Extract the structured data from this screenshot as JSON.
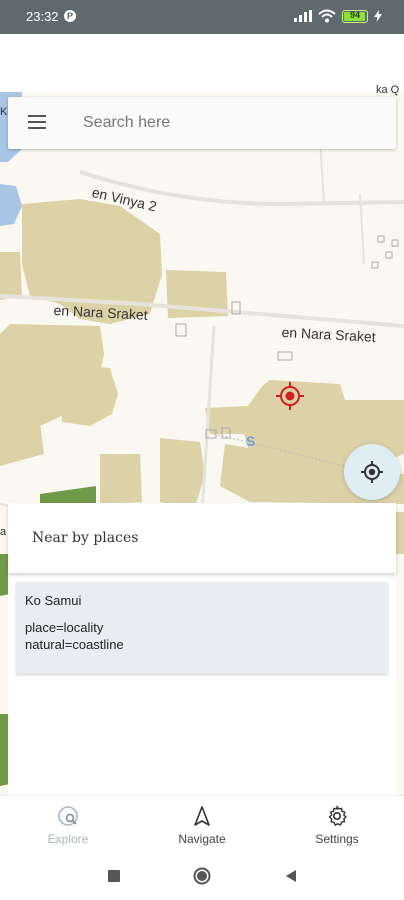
{
  "status_bar": {
    "time": "23:32",
    "notification_glyph": "P",
    "battery_level": "94",
    "icons": [
      "signal-icon",
      "wifi-icon",
      "battery-icon",
      "charging-icon"
    ]
  },
  "search": {
    "placeholder": "Search here"
  },
  "map": {
    "roads": [
      "en Vinya 2",
      "en Nara Sraket",
      "en Nara Sraket"
    ],
    "corner_label": "Ko",
    "top_right_label": "ka Q",
    "left_edge_label": "a",
    "colors": {
      "background": "#fbf8f2",
      "landuse": "#ddd1a8",
      "water": "#a9c5e6",
      "park": "#6f9a47",
      "marker": "#d21f1f"
    }
  },
  "sheet": {
    "title": "Near by places",
    "places": [
      {
        "name": "Ko Samui",
        "tags": [
          "place=locality",
          "natural=coastline"
        ]
      }
    ]
  },
  "bottom_nav": {
    "items": [
      {
        "label": "Explore",
        "icon": "explore-icon",
        "active": false
      },
      {
        "label": "Navigate",
        "icon": "navigate-icon",
        "active": true
      },
      {
        "label": "Settings",
        "icon": "gear-icon",
        "active": true
      }
    ]
  },
  "system_nav": [
    "recents-button",
    "home-button",
    "back-button"
  ]
}
